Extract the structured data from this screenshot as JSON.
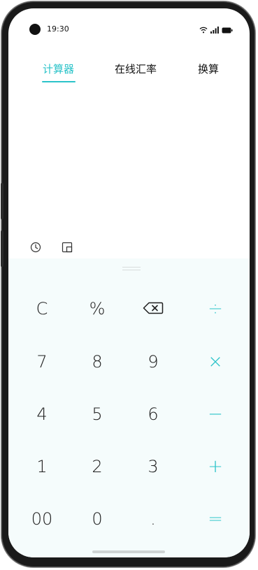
{
  "status": {
    "time": "19:30",
    "icons": [
      "wifi-icon",
      "signal-icon",
      "battery-icon"
    ]
  },
  "tabs": [
    {
      "label": "计算器",
      "active": true
    },
    {
      "label": "在线汇率",
      "active": false
    },
    {
      "label": "换算",
      "active": false
    }
  ],
  "tools": [
    "history-icon",
    "mini-window-icon"
  ],
  "keypad": {
    "rows": [
      [
        {
          "label": "C",
          "name": "clear-key"
        },
        {
          "label": "%",
          "name": "percent-key"
        },
        {
          "label": "",
          "name": "backspace-key",
          "icon": "backspace-icon"
        },
        {
          "label": "÷",
          "name": "divide-key",
          "op": true
        }
      ],
      [
        {
          "label": "7",
          "name": "key-7"
        },
        {
          "label": "8",
          "name": "key-8"
        },
        {
          "label": "9",
          "name": "key-9"
        },
        {
          "label": "×",
          "name": "multiply-key",
          "op": true
        }
      ],
      [
        {
          "label": "4",
          "name": "key-4"
        },
        {
          "label": "5",
          "name": "key-5"
        },
        {
          "label": "6",
          "name": "key-6"
        },
        {
          "label": "−",
          "name": "minus-key",
          "op": true
        }
      ],
      [
        {
          "label": "1",
          "name": "key-1"
        },
        {
          "label": "2",
          "name": "key-2"
        },
        {
          "label": "3",
          "name": "key-3"
        },
        {
          "label": "+",
          "name": "plus-key",
          "op": true
        }
      ],
      [
        {
          "label": "00",
          "name": "key-00"
        },
        {
          "label": "0",
          "name": "key-0"
        },
        {
          "label": ".",
          "name": "decimal-key"
        },
        {
          "label": "=",
          "name": "equals-key",
          "op": true
        }
      ]
    ]
  },
  "colors": {
    "accent": "#2bc3c9",
    "keypad_bg": "#f5fcfc",
    "text": "#1f1f1f"
  }
}
